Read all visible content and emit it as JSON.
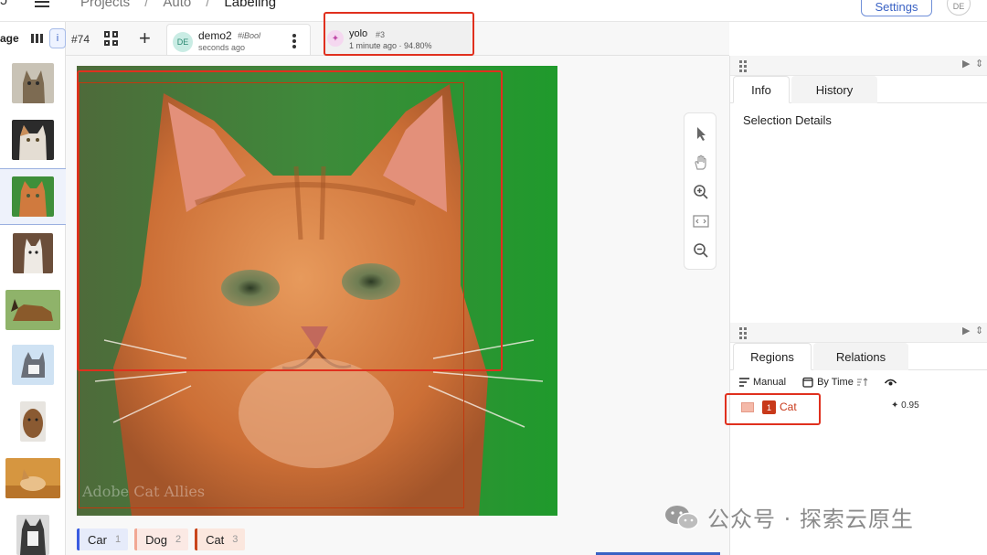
{
  "header": {
    "breadcrumb": [
      "Projects",
      "Auto",
      "Labeling"
    ],
    "separator": "/",
    "settings_label": "Settings",
    "user_initials": "DE"
  },
  "sidebar": {
    "cut_label": "age",
    "info_label": "i",
    "thumbnails": [
      "cat-tabby",
      "cat-white",
      "cat-orange",
      "dog-white",
      "dog-shepherd",
      "dog-husky-snow",
      "dog-brown",
      "dog-corgi-autumn",
      "dog-husky"
    ]
  },
  "task_tabs": {
    "task_id": "#74",
    "annotation_tab": {
      "initials": "DE",
      "name": "demo2",
      "tag": "#iBool",
      "time": "seconds ago"
    },
    "prediction_tab": {
      "name": "yolo",
      "tag": "#3",
      "meta": "1 minute ago · 94.80%"
    }
  },
  "canvas": {
    "image_watermark": "Adobe Cat Allies",
    "tools": [
      "pointer-icon",
      "hand-icon",
      "zoom-in-icon",
      "fit-screen-icon",
      "zoom-out-icon"
    ],
    "labels": [
      {
        "name": "Car",
        "hotkey": "1",
        "color": "#3a5ce0"
      },
      {
        "name": "Dog",
        "hotkey": "2",
        "color": "#f1a894"
      },
      {
        "name": "Cat",
        "hotkey": "3",
        "color": "#c8451c"
      }
    ]
  },
  "right_panel": {
    "info_tabs": [
      "Info",
      "History"
    ],
    "selection_title": "Selection Details",
    "region_tabs": [
      "Regions",
      "Relations"
    ],
    "filters": {
      "manual": "Manual",
      "by_time": "By Time"
    },
    "regions": [
      {
        "index": "1",
        "label": "Cat",
        "score": "0.95",
        "color": "#c8391a"
      }
    ]
  },
  "watermark": {
    "text": "公众号 · 探索云原生"
  }
}
